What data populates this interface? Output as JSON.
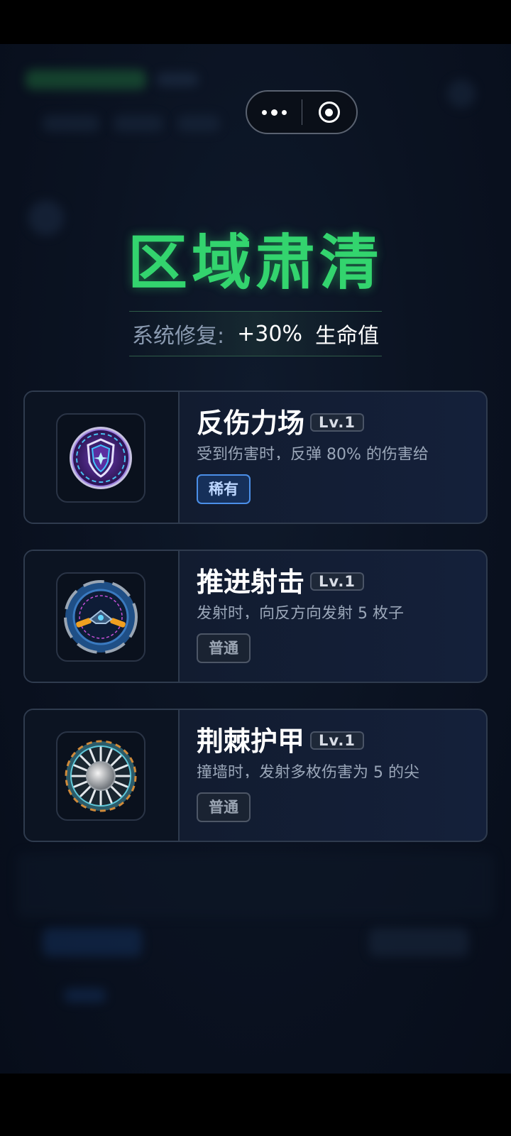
{
  "capsule": {
    "more_icon": "more-dots-icon",
    "close_icon": "target-circle-icon"
  },
  "result": {
    "title": "区域肃清",
    "bonus_label": "系统修复:",
    "bonus_value": "+30%",
    "bonus_unit": "生命值"
  },
  "cards": [
    {
      "name": "反伤力场",
      "level": "Lv.1",
      "desc": "受到伤害时，反弹 80% 的伤害给",
      "rarity": "稀有",
      "rarity_kind": "rare",
      "icon": "shield-icon"
    },
    {
      "name": "推进射击",
      "level": "Lv.1",
      "desc": "发射时，向反方向发射 5 枚子",
      "rarity": "普通",
      "rarity_kind": "common",
      "icon": "thruster-ship-icon"
    },
    {
      "name": "荆棘护甲",
      "level": "Lv.1",
      "desc": "撞墙时，发射多枚伤害为 5 的尖",
      "rarity": "普通",
      "rarity_kind": "common",
      "icon": "spike-wheel-icon"
    }
  ],
  "colors": {
    "title": "#33d46e",
    "rare": "#4b8fe8",
    "common": "#4d5666",
    "background": "#0b1322"
  }
}
